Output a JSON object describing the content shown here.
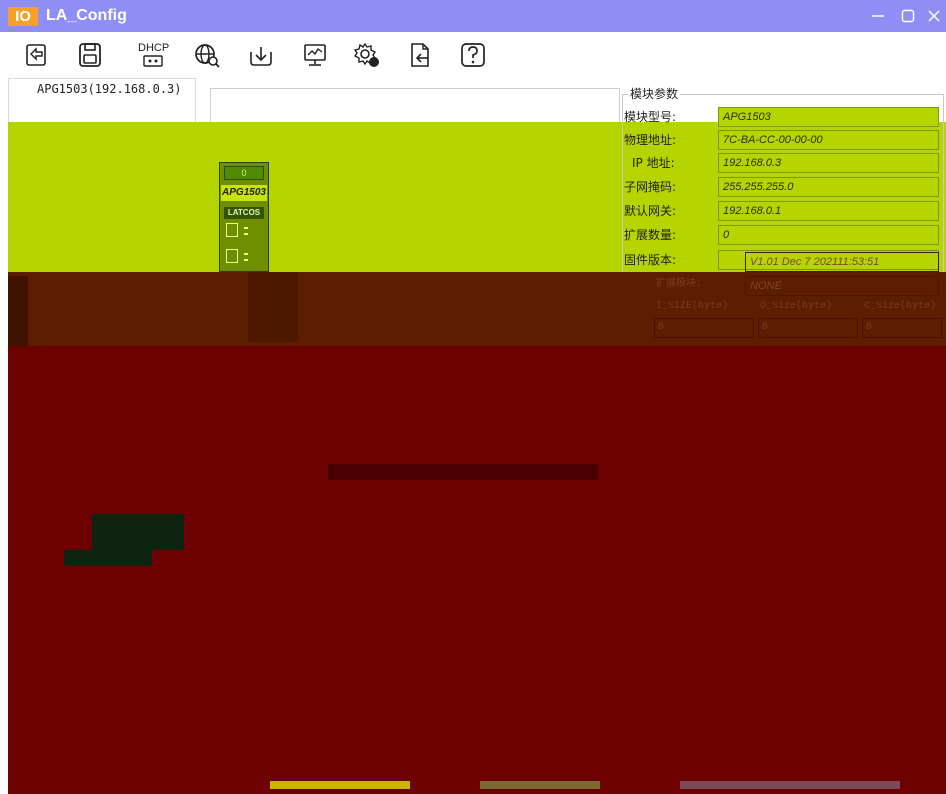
{
  "window": {
    "badge": "IO",
    "title": "LA_Config",
    "controls": [
      "minimize",
      "maximize",
      "close"
    ]
  },
  "toolbar": {
    "dhcp_label": "DHCP",
    "icons": [
      "scan-icon",
      "save-icon",
      "dhcp-icon",
      "network-search-icon",
      "download-icon",
      "monitor-icon",
      "settings-icon",
      "export-icon",
      "help-icon"
    ]
  },
  "tree": {
    "device": "APG1503(192.168.0.3)"
  },
  "device_view": {
    "slot": "0",
    "module_name": "APG1503",
    "brand": "LATCOS"
  },
  "params": {
    "title": "模块参数",
    "rows": [
      {
        "label": "模块型号:",
        "value": "APG1503"
      },
      {
        "label": "物理地址:",
        "value": "7C-BA-CC-00-00-00"
      },
      {
        "label": "IP 地址:",
        "value": "192.168.0.3"
      },
      {
        "label": "子网掩码:",
        "value": "255.255.255.0"
      },
      {
        "label": "默认网关:",
        "value": "192.168.0.1"
      },
      {
        "label": "扩展数量:",
        "value": "0"
      },
      {
        "label": "固件版本:",
        "value": "V1.01 Dec 7 202111:53:51"
      },
      {
        "label": "扩展模块:",
        "value": "NONE"
      }
    ],
    "size_columns": [
      "I_SIZE(byte)",
      "O_Size(byte)",
      "C_Size(byte)"
    ],
    "size_values": [
      "0",
      "0",
      "0"
    ]
  },
  "colors": {
    "titlebar": "#8f8ef5",
    "badge": "#f3a12a",
    "highlight": "#b6d400",
    "band": "#5c1d00",
    "panel": "#6d0000"
  }
}
